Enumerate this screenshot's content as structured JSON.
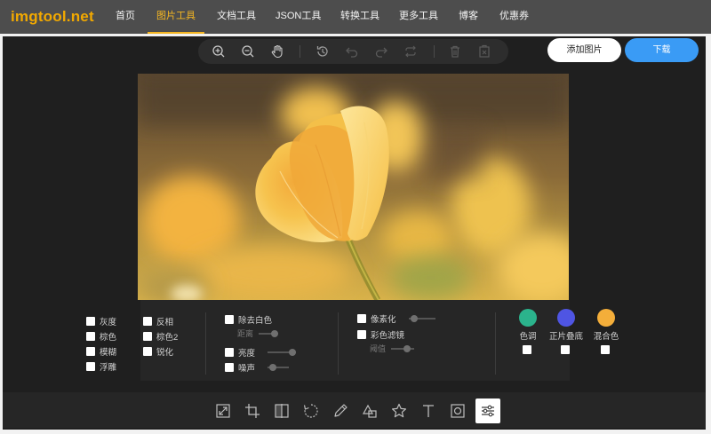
{
  "site": {
    "logo": "imgtool.net"
  },
  "nav": [
    "首页",
    "图片工具",
    "文档工具",
    "JSON工具",
    "转换工具",
    "更多工具",
    "博客",
    "优惠券"
  ],
  "nav_active": "图片工具",
  "toolbar": {
    "icons": [
      "zoom-in-icon",
      "zoom-out-icon",
      "hand-icon",
      "history-icon",
      "undo-icon",
      "redo-icon",
      "repeat-icon",
      "delete-icon",
      "delete-all-icon"
    ]
  },
  "actions": {
    "add_image": "添加图片",
    "download": "下载"
  },
  "filters": {
    "basic": [
      {
        "label": "灰度",
        "checked": false
      },
      {
        "label": "棕色",
        "checked": false
      },
      {
        "label": "模糊",
        "checked": false
      },
      {
        "label": "浮雕",
        "checked": false
      },
      {
        "label": "反相",
        "checked": false
      },
      {
        "label": "棕色2",
        "checked": false
      },
      {
        "label": "锐化",
        "checked": false
      }
    ],
    "remove_white": {
      "label": "除去白色",
      "sub_label": "距离"
    },
    "brightness": {
      "label": "亮度"
    },
    "noise": {
      "label": "噪声"
    },
    "pixelate": {
      "label": "像素化"
    },
    "color_filter": {
      "label": "彩色滤镜",
      "sub_label": "阈值"
    },
    "blend": [
      {
        "label": "色调",
        "color": "#2bb38c"
      },
      {
        "label": "正片叠底",
        "color": "#4f55e3"
      },
      {
        "label": "混合色",
        "color": "#f4ae3a"
      }
    ]
  },
  "bottom_tools": {
    "icons": [
      "resize-icon",
      "crop-icon",
      "flip-icon",
      "rotate-icon",
      "draw-icon",
      "shape-icon",
      "star-icon",
      "text-icon",
      "frame-icon",
      "filter-icon"
    ],
    "active": "filter-icon"
  }
}
